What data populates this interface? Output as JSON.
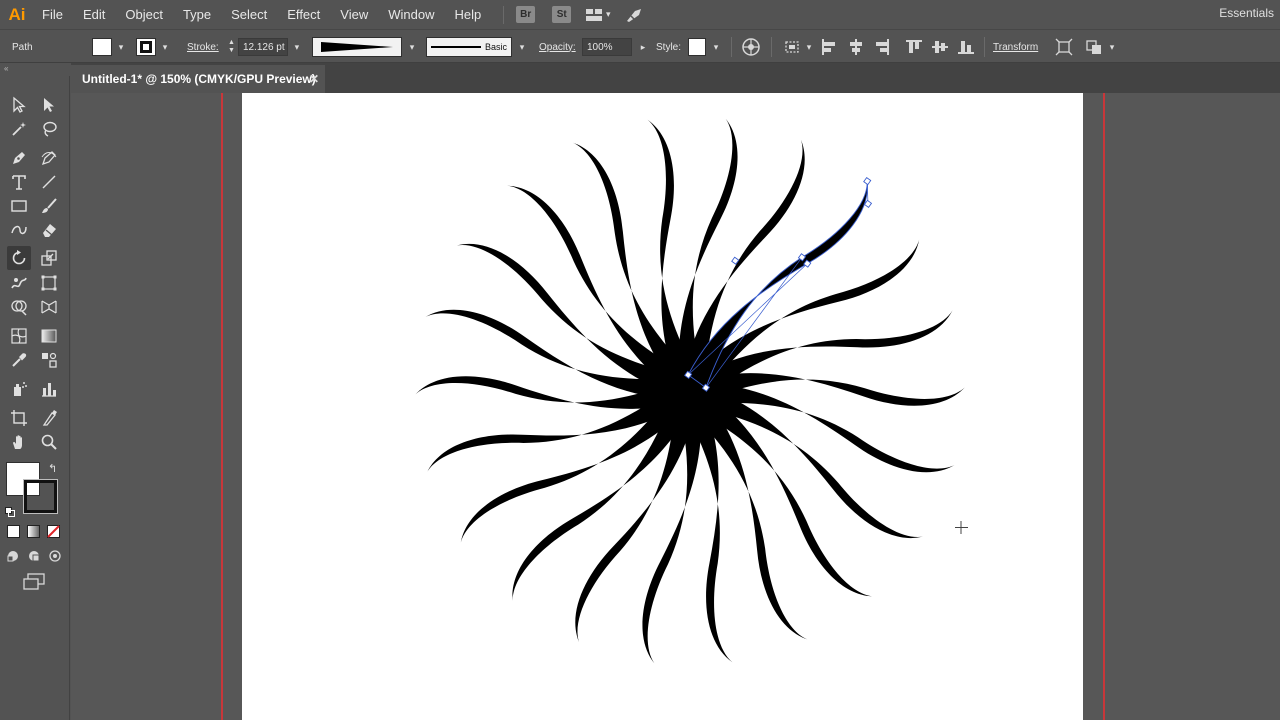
{
  "app": {
    "logo": "Ai",
    "workspace": "Essentials"
  },
  "menu": [
    "File",
    "Edit",
    "Object",
    "Type",
    "Select",
    "Effect",
    "View",
    "Window",
    "Help"
  ],
  "bridge_badges": [
    "Br",
    "St"
  ],
  "control": {
    "selection_label": "Path",
    "stroke_label": "Stroke:",
    "stroke_weight": "12.126 pt",
    "brush_label": "Basic",
    "opacity_label": "Opacity:",
    "opacity_value": "100%",
    "style_label": "Style:",
    "transform_label": "Transform"
  },
  "document": {
    "tab_title": "Untitled-1* @ 150% (CMYK/GPU Preview)",
    "close_glyph": "✕"
  },
  "colors": {
    "ui_background": "#535353",
    "tab_bar": "#434343",
    "canvas": "#575757",
    "artboard": "#ffffff",
    "bleed_guide": "#c8373a",
    "selection_path": "#3a5ecf",
    "artwork_fill": "#000000"
  },
  "artwork": {
    "petal_count": 22,
    "selected_petal_index": 0
  }
}
